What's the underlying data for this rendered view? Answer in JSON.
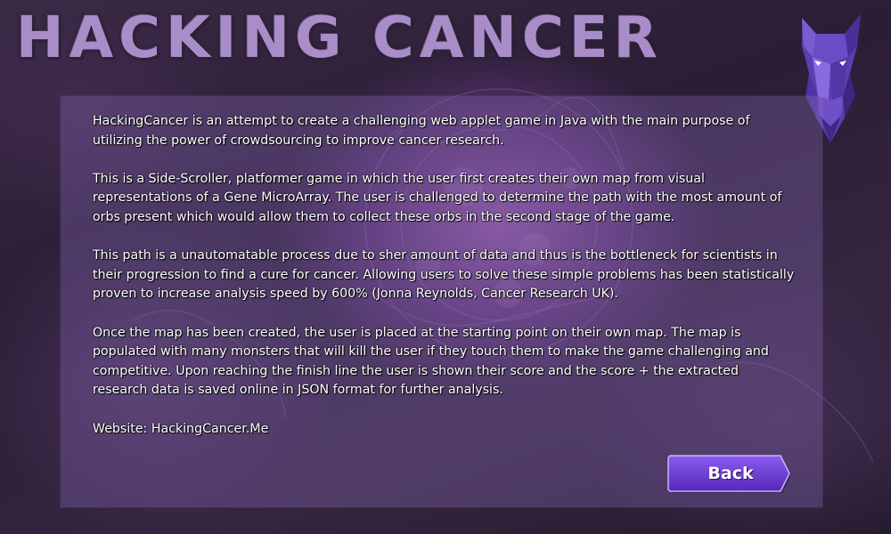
{
  "game": {
    "title": "HACKING CANCER"
  },
  "about": {
    "paragraphs": [
      "HackingCancer is an attempt to create a challenging web applet game in Java with the main purpose of utilizing the power of crowdsourcing to improve cancer research.",
      "This is a Side-Scroller, platformer game in which the user first creates their own map from visual representations of a Gene MicroArray. The user is challenged to determine the path with the most amount of orbs present which would allow them to collect these orbs in the second stage of the game.",
      "This path is a unautomatable process due to sher amount of data and thus is the bottleneck for scientists in their progression to find a cure for cancer. Allowing users to solve these simple problems has been statistically proven to increase analysis speed by 600% (Jonna Reynolds, Cancer Research UK).",
      "Once the map has been created, the user is placed at the starting point on their own map. The map is populated with many monsters that will kill the user if they touch them to make the game challenging and competitive. Upon reaching the finish line the user is shown their score and the score + the extracted research data is saved online in JSON format for further analysis."
    ],
    "website": "Website: HackingCancer.Me"
  },
  "buttons": {
    "back_label": "Back"
  },
  "icons": {
    "logo": "horse-head-icon"
  },
  "colors": {
    "title": "#a98dc8",
    "panel": "#8c6ebe",
    "button": "#6a3fd0",
    "text": "#ffffff"
  }
}
